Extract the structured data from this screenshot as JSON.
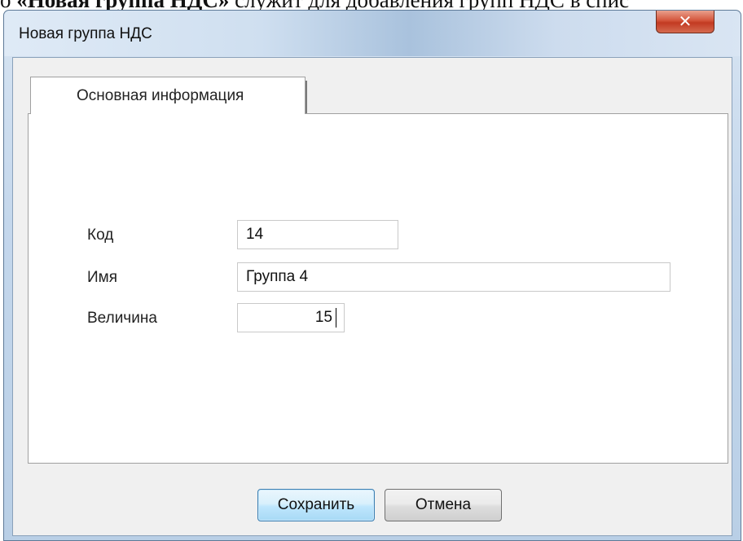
{
  "document": {
    "prefix": "о ",
    "bold_title": "«Новая группа НДС»",
    "suffix": " служит для добавления групп НДС в спис"
  },
  "window": {
    "title": "Новая группа НДС",
    "close_glyph": "✕"
  },
  "tabs": [
    {
      "label": "Основная информация",
      "selected": true
    }
  ],
  "form": {
    "code": {
      "label": "Код",
      "value": "14"
    },
    "name": {
      "label": "Имя",
      "value": "Группа 4"
    },
    "amount": {
      "label": "Величина",
      "value": "15"
    }
  },
  "buttons": {
    "save_label": "Сохранить",
    "cancel_label": "Отмена"
  },
  "colors": {
    "close_button": "#c8442a",
    "default_button_border": "#3c7fb1"
  }
}
